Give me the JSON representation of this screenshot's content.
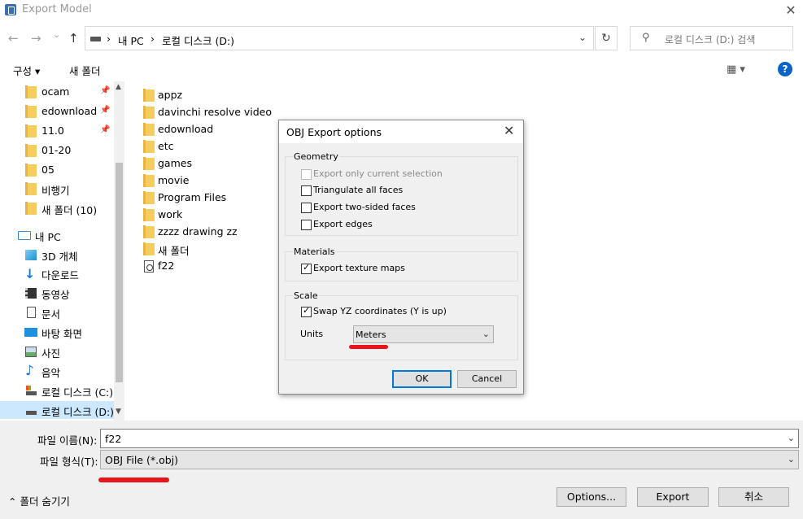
{
  "window": {
    "title": "Export Model",
    "close_glyph": "✕"
  },
  "nav": {
    "back": "←",
    "forward": "→",
    "recent": "⌄",
    "up": "↑",
    "breadcrumbs": [
      "내 PC",
      "로컬 디스크 (D:)"
    ],
    "separator": "›",
    "dropdown_glyph": "⌄",
    "refresh_glyph": "↻",
    "search_placeholder": "로컬 디스크 (D:) 검색",
    "search_glyph": "⚲"
  },
  "toolbar": {
    "organize": "구성 ▾",
    "new_folder": "새 폴더",
    "view_glyph": "▦ ▾",
    "help_glyph": "?"
  },
  "sidebar": {
    "quick": [
      "ocam",
      "edownload",
      "11.0",
      "01-20",
      "05",
      "비행기",
      "새 폴더 (10)"
    ],
    "pc_label": "내 PC",
    "pc_items": [
      "3D 개체",
      "다운로드",
      "동영상",
      "문서",
      "바탕 화면",
      "사진",
      "음악",
      "로컬 디스크 (C:)",
      "로컬 디스크 (D:)"
    ],
    "pin_glyph": "📌"
  },
  "files": [
    "appz",
    "davinchi resolve video",
    "edownload",
    "etc",
    "games",
    "movie",
    "Program Files",
    "work",
    "zzzz drawing zz",
    "새 폴더"
  ],
  "file_item": "f22",
  "bottom": {
    "filename_label": "파일 이름(N):",
    "filename_value": "f22",
    "filetype_label": "파일 형식(T):",
    "filetype_value": "OBJ File (*.obj)",
    "hide_folders": "⌃ 폴더 숨기기",
    "options_button": "Options...",
    "export_button": "Export",
    "cancel_button": "취소"
  },
  "dialog": {
    "title": "OBJ Export options",
    "close_glyph": "✕",
    "geometry": {
      "label": "Geometry",
      "options": [
        {
          "label": "Export only current selection",
          "checked": false,
          "disabled": true
        },
        {
          "label": "Triangulate all faces",
          "checked": false,
          "disabled": false
        },
        {
          "label": "Export two-sided faces",
          "checked": false,
          "disabled": false
        },
        {
          "label": "Export edges",
          "checked": false,
          "disabled": false
        }
      ]
    },
    "materials": {
      "label": "Materials",
      "option": "Export texture maps",
      "checked": true
    },
    "scale": {
      "label": "Scale",
      "option": "Swap YZ coordinates (Y is up)",
      "checked": true,
      "units_label": "Units",
      "units_value": "Meters"
    },
    "ok": "OK",
    "cancel": "Cancel"
  },
  "colors": {
    "accent": "#0078d7",
    "annotation": "#e8141a",
    "selection": "#cce8ff",
    "folder": "#f5cd5e"
  }
}
